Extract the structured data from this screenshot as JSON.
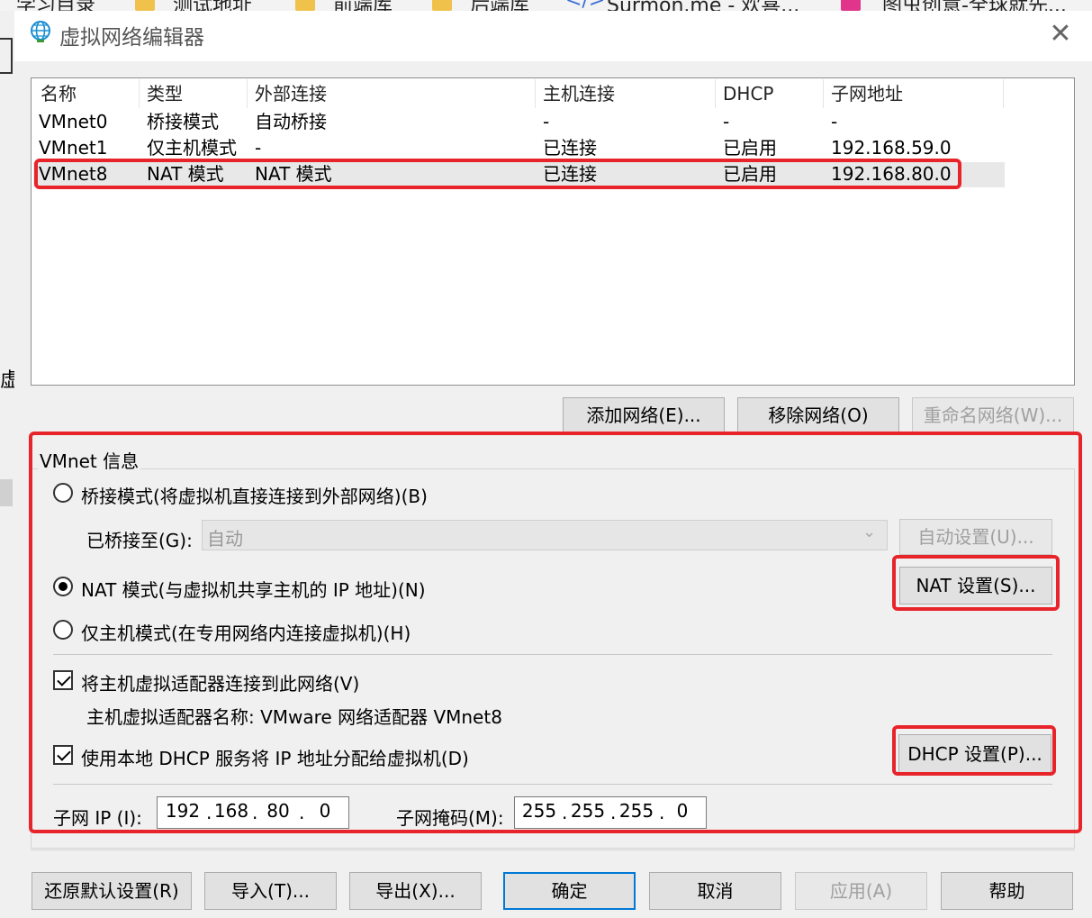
{
  "background": {
    "bookmarks": [
      "学习目录",
      "测试地址",
      "前端库",
      "后端库",
      "Surmon.me - 欢喜...",
      "图虫创意-全球就先..."
    ],
    "side_char": "虚"
  },
  "window": {
    "title": "虚拟网络编辑器",
    "close_glyph": "✕"
  },
  "network_list": {
    "columns": [
      "名称",
      "类型",
      "外部连接",
      "主机连接",
      "DHCP",
      "子网地址"
    ],
    "rows": [
      {
        "name": "VMnet0",
        "type": "桥接模式",
        "external": "自动桥接",
        "host": "-",
        "dhcp": "-",
        "subnet": "-"
      },
      {
        "name": "VMnet1",
        "type": "仅主机模式",
        "external": "-",
        "host": "已连接",
        "dhcp": "已启用",
        "subnet": "192.168.59.0"
      },
      {
        "name": "VMnet8",
        "type": "NAT 模式",
        "external": "NAT 模式",
        "host": "已连接",
        "dhcp": "已启用",
        "subnet": "192.168.80.0"
      }
    ],
    "selected_index": 2
  },
  "list_buttons": {
    "add": "添加网络(E)...",
    "remove": "移除网络(O)",
    "rename": "重命名网络(W)..."
  },
  "vmnet_info": {
    "group_label": "VMnet 信息",
    "bridge_radio": "桥接模式(将虚拟机直接连接到外部网络)(B)",
    "bridged_to_label": "已桥接至(G):",
    "bridged_to_value": "自动",
    "auto_settings": "自动设置(U)...",
    "nat_radio": "NAT 模式(与虚拟机共享主机的 IP 地址)(N)",
    "nat_settings": "NAT 设置(S)...",
    "hostonly_radio": "仅主机模式(在专用网络内连接虚拟机)(H)",
    "connect_adapter_check": "将主机虚拟适配器连接到此网络(V)",
    "adapter_name_label": "主机虚拟适配器名称: VMware 网络适配器 VMnet8",
    "dhcp_check": "使用本地 DHCP 服务将 IP 地址分配给虚拟机(D)",
    "dhcp_settings": "DHCP 设置(P)...",
    "subnet_ip_label": "子网 IP (I):",
    "subnet_ip": [
      "192",
      "168",
      "80",
      "0"
    ],
    "subnet_mask_label": "子网掩码(M):",
    "subnet_mask": [
      "255",
      "255",
      "255",
      "0"
    ]
  },
  "footer_buttons": {
    "restore": "还原默认设置(R)",
    "import": "导入(T)...",
    "export": "导出(X)...",
    "ok": "确定",
    "cancel": "取消",
    "apply": "应用(A)",
    "help": "帮助"
  },
  "colors": {
    "annotation_red": "#e8242b",
    "dialog_bg": "#f0f0f0",
    "button_bg": "#e1e1e1",
    "disabled_text": "#a0a0a0"
  }
}
